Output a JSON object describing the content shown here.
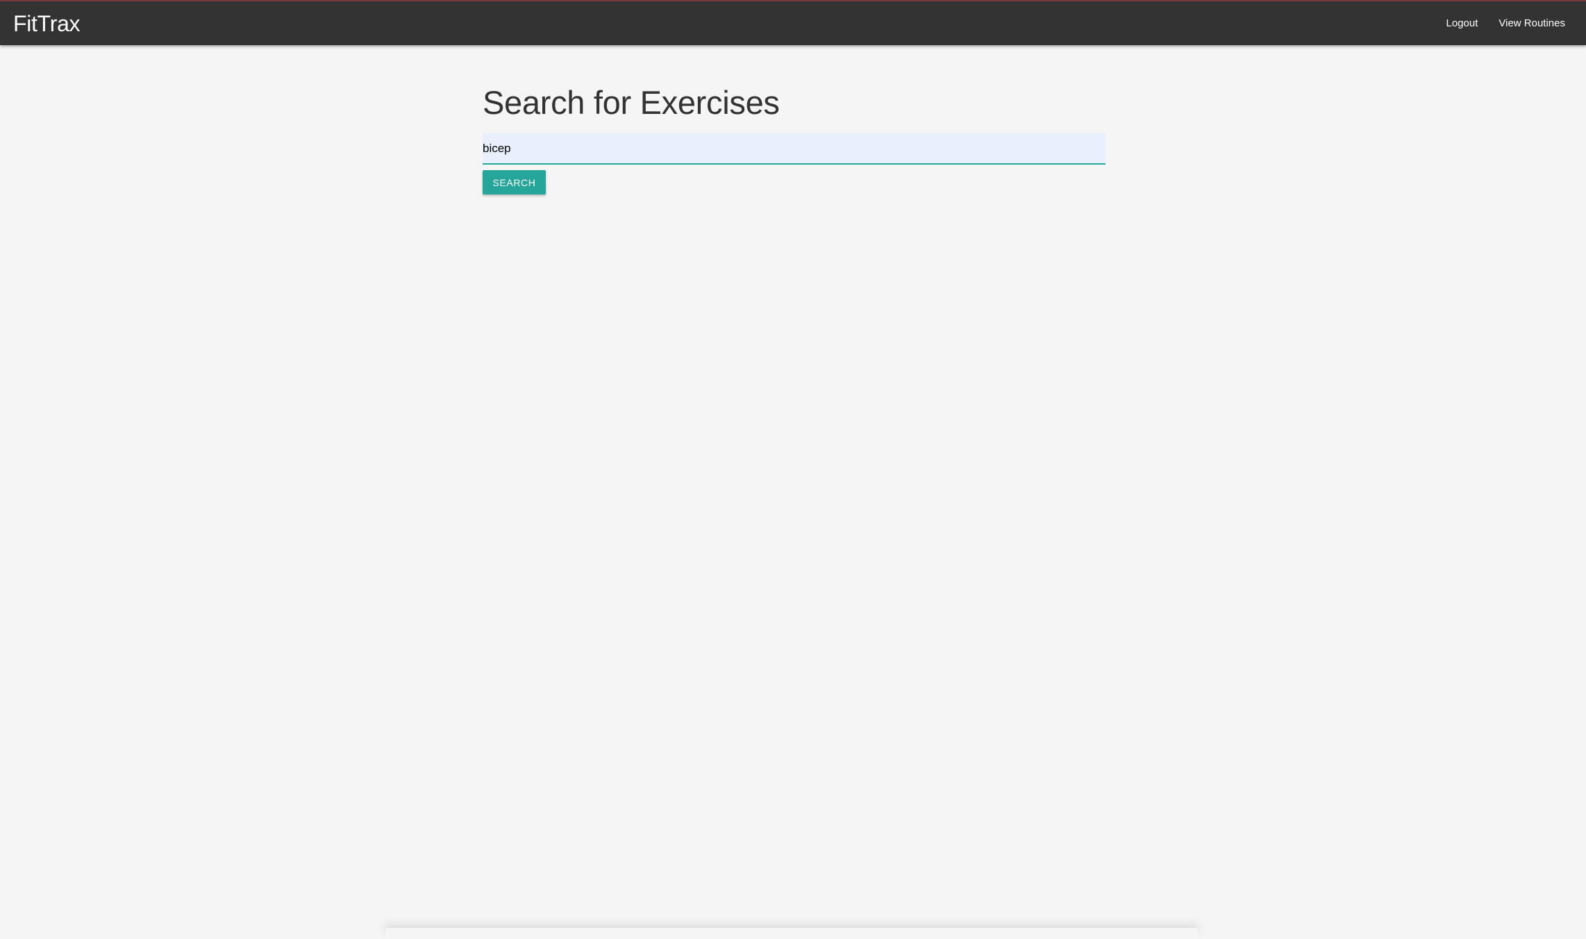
{
  "navbar": {
    "brand": "FitTrax",
    "links": [
      {
        "label": "Logout"
      },
      {
        "label": "View Routines"
      }
    ],
    "background": "#333333"
  },
  "main": {
    "title": "Search for Exercises",
    "search": {
      "value": "bicep",
      "placeholder": ""
    },
    "button_label": "SEARCH",
    "accent": "#26a69a"
  }
}
